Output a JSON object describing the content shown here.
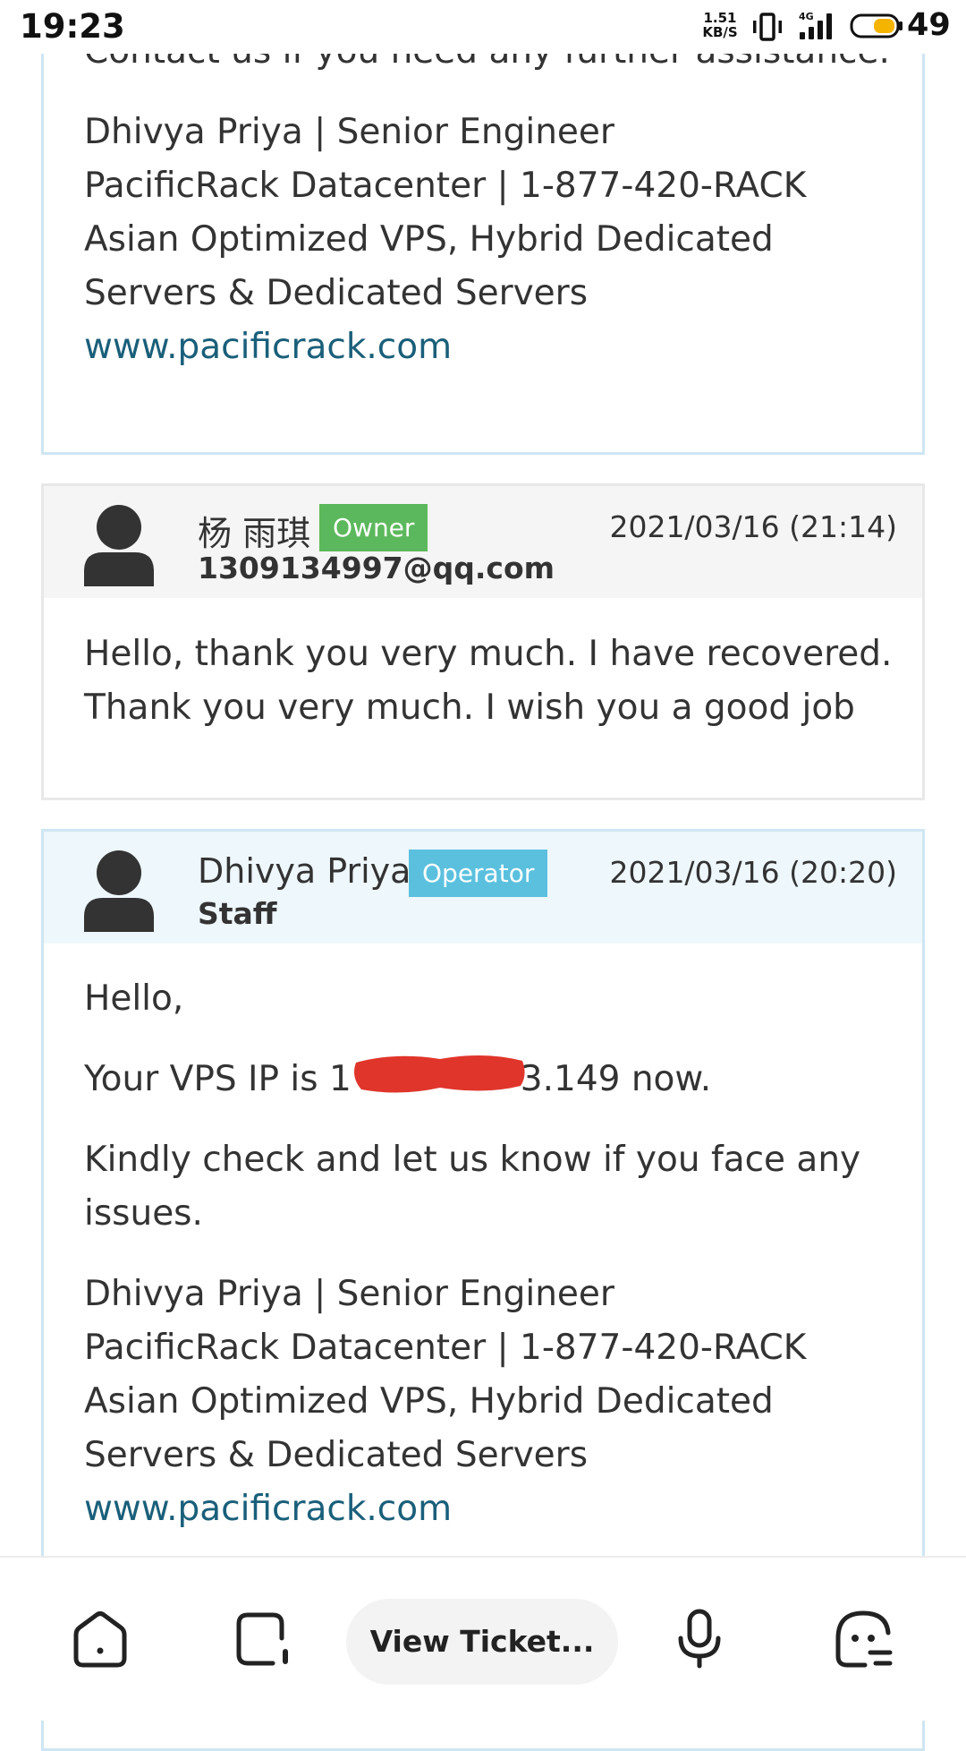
{
  "status_bar": {
    "time": "19:23",
    "net_speed_value": "1.51",
    "net_speed_unit": "KB/S",
    "network_type": "4G",
    "battery_percent": "49"
  },
  "previous_reply": {
    "lines": [
      "Contact us if you need any further assistance.",
      "Dhivya Priya | Senior Engineer",
      "PacificRack Datacenter | 1-877-420-RACK",
      "Asian Optimized VPS, Hybrid Dedicated",
      "Servers & Dedicated Servers"
    ],
    "link": "www.pacificrack.com"
  },
  "owner_reply": {
    "name": "杨 雨琪",
    "badge": "Owner",
    "email": "1309134997@qq.com",
    "date": "2021/03/16 (21:14)",
    "lines": [
      "Hello, thank you very much. I have recovered.",
      "Thank you very much. I wish you a good job"
    ]
  },
  "staff_reply": {
    "name": "Dhivya Priya",
    "badge": "Operator",
    "role": "Staff",
    "date": "2021/03/16 (20:20)",
    "greeting": "Hello,",
    "ip_line_prefix": "Your VPS IP is 1",
    "ip_line_suffix": "3.149 now.",
    "check_line_1": "Kindly check and let us know if you face any",
    "check_line_2": "issues.",
    "signature": [
      "Dhivya Priya | Senior Engineer",
      "PacificRack Datacenter | 1-877-420-RACK",
      "Asian Optimized VPS, Hybrid Dedicated",
      "Servers & Dedicated Servers"
    ],
    "link": "www.pacificrack.com"
  },
  "bottom_nav": {
    "view_ticket_label": "View Ticket..."
  },
  "colors": {
    "owner_badge": "#5cb85c",
    "operator_badge": "#5bc0de",
    "link": "#1a5f7a",
    "redaction": "#e0352b"
  }
}
